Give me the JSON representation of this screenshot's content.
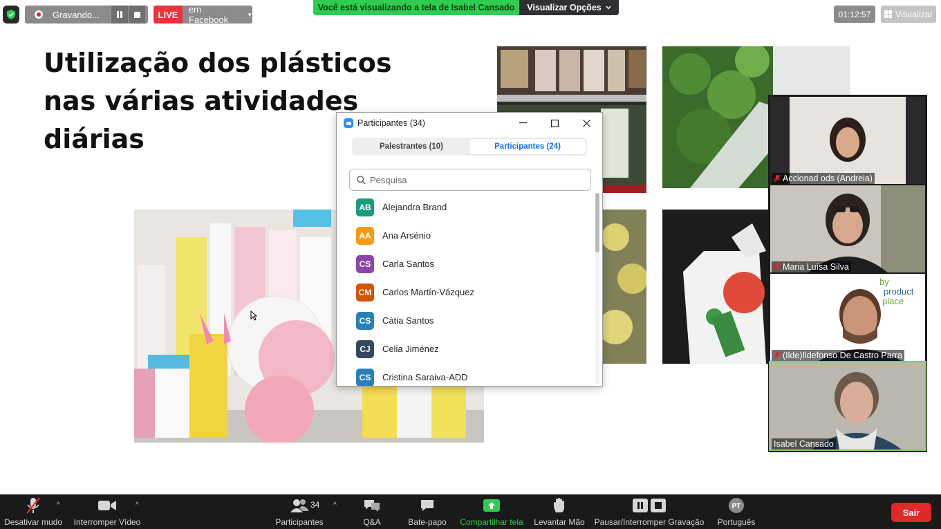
{
  "top_bar": {
    "recording_label": "Gravando...",
    "live_tag": "LIVE",
    "live_destination": "em Facebook",
    "share_message": "Você está visualizando a tela de Isabel Cansado",
    "view_options": "Visualizar Opções",
    "timer": "01:12:57",
    "view_label": "Visualizar"
  },
  "slide": {
    "title_line1": "Utilização dos plásticos",
    "title_line2": "nas várias atividades",
    "title_line3": "diárias"
  },
  "participants_panel": {
    "title": "Participantes (34)",
    "tabs": [
      {
        "label": "Palestrantes (10)",
        "active": false
      },
      {
        "label": "Participantes (24)",
        "active": true
      }
    ],
    "search_placeholder": "Pesquisa",
    "list": [
      {
        "initials": "AB",
        "name": "Alejandra Brand",
        "color": "#1a9a7f"
      },
      {
        "initials": "AA",
        "name": "Ana Arsénio",
        "color": "#f39c12"
      },
      {
        "initials": "CS",
        "name": "Carla Santos",
        "color": "#8e44ad"
      },
      {
        "initials": "CM",
        "name": "Carlos Martín-Vázquez",
        "color": "#d35400"
      },
      {
        "initials": "CS",
        "name": "Cátia Santos",
        "color": "#2980b9"
      },
      {
        "initials": "CJ",
        "name": "Celia Jiménez",
        "color": "#34495e"
      },
      {
        "initials": "CS",
        "name": "Cristina Saraiva-ADD",
        "color": "#2980b9"
      }
    ]
  },
  "videos": [
    {
      "name": "Accionad ods (Andreia)",
      "muted": true
    },
    {
      "name": "Maria Luísa Silva",
      "muted": true
    },
    {
      "name": "(Ilde)Ildefonso De Castro Parra",
      "muted": true
    },
    {
      "name": "Isabel Cansado",
      "muted": false
    }
  ],
  "toolbar": {
    "mute_label": "Desativar mudo",
    "video_label": "Interromper Vídeo",
    "participants_label": "Participantes",
    "participants_count": "34",
    "qa_label": "Q&A",
    "chat_label": "Bate-papo",
    "share_label": "Compartilhar tela",
    "raise_hand_label": "Levantar Mão",
    "pause_rec_label": "Pausar/Interromper Gravação",
    "language_label": "Português",
    "language_code": "PT",
    "leave_label": "Sair"
  }
}
